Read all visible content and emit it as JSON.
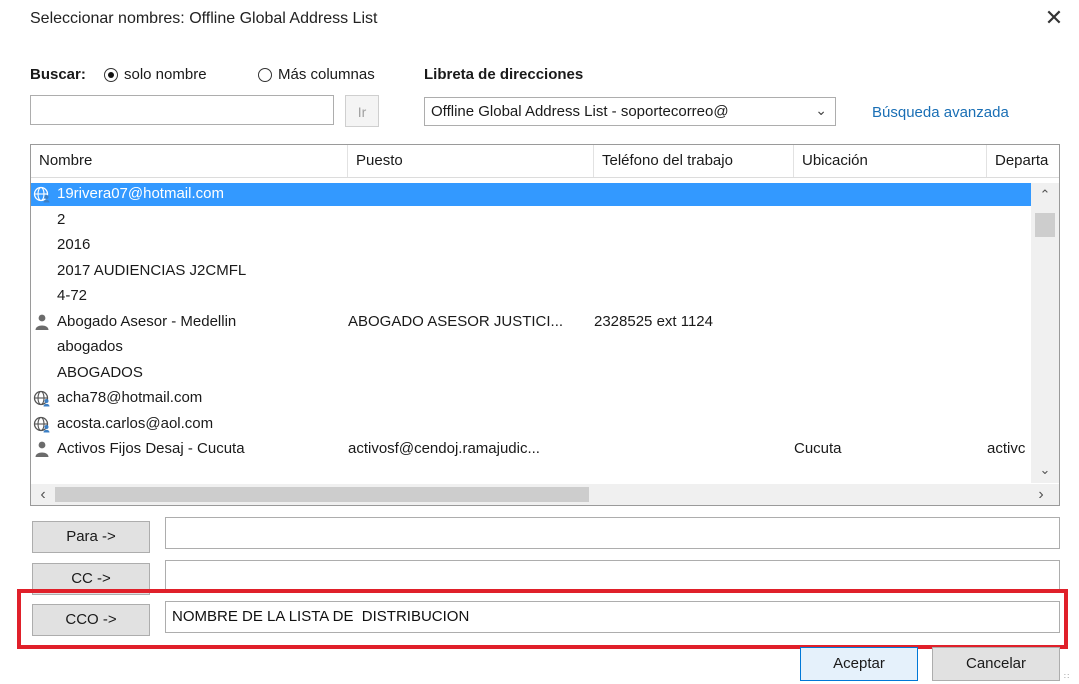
{
  "window": {
    "title": "Seleccionar nombres: Offline Global Address List",
    "close_symbol": "✕"
  },
  "search": {
    "label": "Buscar:",
    "radio_name_only": "solo nombre",
    "radio_more_columns": "Más columnas",
    "input_value": "",
    "go_label": "Ir"
  },
  "address_book": {
    "label": "Libreta de direcciones",
    "selected": "Offline Global Address List - soportecorreo@",
    "advanced_search": "Búsqueda avanzada"
  },
  "table": {
    "columns": [
      "Nombre",
      "Puesto",
      "Teléfono del trabajo",
      "Ubicación",
      "Departa"
    ],
    "rows": [
      {
        "icon": "globe-contact-icon",
        "name": "19rivera07@hotmail.com",
        "title": "",
        "phone": "",
        "location": "",
        "dept": "",
        "selected": true
      },
      {
        "icon": "",
        "name": "2",
        "title": "",
        "phone": "",
        "location": "",
        "dept": "",
        "selected": false
      },
      {
        "icon": "",
        "name": "2016",
        "title": "",
        "phone": "",
        "location": "",
        "dept": "",
        "selected": false
      },
      {
        "icon": "",
        "name": "2017 AUDIENCIAS J2CMFL",
        "title": "",
        "phone": "",
        "location": "",
        "dept": "",
        "selected": false
      },
      {
        "icon": "",
        "name": "4-72",
        "title": "",
        "phone": "",
        "location": "",
        "dept": "",
        "selected": false
      },
      {
        "icon": "person-icon",
        "name": "Abogado Asesor - Medellin",
        "title": "ABOGADO ASESOR JUSTICI...",
        "phone": "2328525 ext 1124",
        "location": "",
        "dept": "",
        "selected": false
      },
      {
        "icon": "",
        "name": "abogados",
        "title": "",
        "phone": "",
        "location": "",
        "dept": "",
        "selected": false
      },
      {
        "icon": "",
        "name": "ABOGADOS",
        "title": "",
        "phone": "",
        "location": "",
        "dept": "",
        "selected": false
      },
      {
        "icon": "globe-contact-icon",
        "name": "acha78@hotmail.com",
        "title": "",
        "phone": "",
        "location": "",
        "dept": "",
        "selected": false
      },
      {
        "icon": "globe-contact-icon",
        "name": "acosta.carlos@aol.com",
        "title": "",
        "phone": "",
        "location": "",
        "dept": "",
        "selected": false
      },
      {
        "icon": "person-icon",
        "name": "Activos Fijos Desaj - Cucuta",
        "title": "activosf@cendoj.ramajudic...",
        "phone": "",
        "location": "Cucuta",
        "dept": "activc",
        "selected": false
      }
    ]
  },
  "recipients": {
    "to_label": "Para ->",
    "to_value": "",
    "cc_label": "CC ->",
    "cc_value": "",
    "bcc_label": "CCO ->",
    "bcc_value": "NOMBRE DE LA LISTA DE  DISTRIBUCION"
  },
  "footer": {
    "ok": "Aceptar",
    "cancel": "Cancelar"
  },
  "colors": {
    "selection": "#3399ff",
    "highlight_box": "#e0202a",
    "link": "#1a6fb5"
  }
}
